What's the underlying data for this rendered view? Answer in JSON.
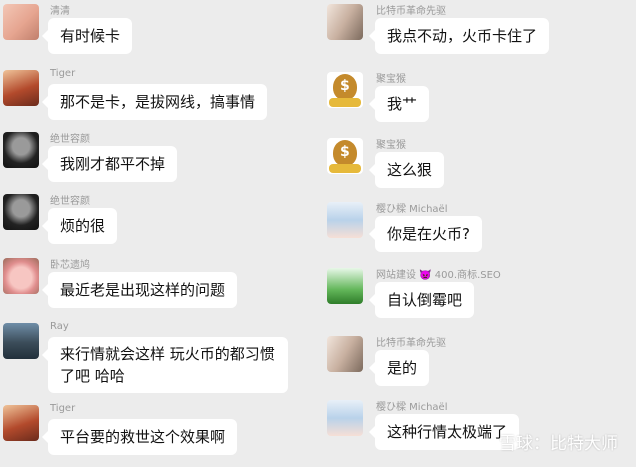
{
  "left_messages": [
    {
      "name": "清清",
      "text": "有时候卡",
      "avatar": "baby-photo"
    },
    {
      "name": "Tiger",
      "text": "那不是卡，是拔网线，搞事情",
      "avatar": "tiger-photo"
    },
    {
      "name": "绝世容颜",
      "text": "我刚才都平不掉",
      "avatar": "man-portrait"
    },
    {
      "name": "绝世容颜",
      "text": "烦的很",
      "avatar": "man-portrait"
    },
    {
      "name": "卧芯遗鸠",
      "text": "最近老是出现这样的问题",
      "avatar": "pig-photo"
    },
    {
      "name": "Ray",
      "text": "来行情就会这样 玩火币的都习惯了吧 哈哈",
      "avatar": "sea-photo"
    },
    {
      "name": "Tiger",
      "text": "平台要的救世这个效果啊",
      "avatar": "tiger-photo"
    }
  ],
  "right_messages": [
    {
      "name": "比特币革命先驱",
      "text": "我点不动，火币卡住了",
      "avatar": "couple-photo"
    },
    {
      "name": "聚宝猴",
      "text": "我艹",
      "avatar": "money-bag"
    },
    {
      "name": "聚宝猴",
      "text": "这么狠",
      "avatar": "money-bag"
    },
    {
      "name": "樱ひ樑 Michaël",
      "text": "你是在火币?",
      "avatar": "anime-girl"
    },
    {
      "name": "网站建设 👿 400.商标.SEO",
      "text": "自认倒霉吧",
      "avatar": "website-banner"
    },
    {
      "name": "比特币革命先驱",
      "text": "是的",
      "avatar": "couple-photo"
    },
    {
      "name": "樱ひ樑 Michaël",
      "text": "这种行情太极端了",
      "avatar": "anime-girl"
    }
  ],
  "watermark": "雪球：比特大师"
}
